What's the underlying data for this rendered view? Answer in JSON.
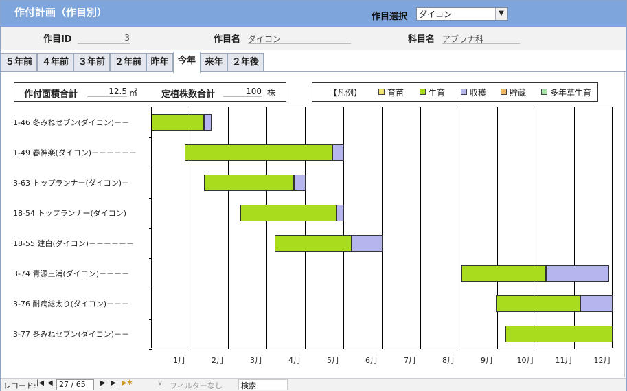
{
  "window": {
    "title": "作付計画（作目別）"
  },
  "header": {
    "crop_select_label": "作目選択",
    "crop_select_value": "ダイコン"
  },
  "info": {
    "crop_id_label": "作目ID",
    "crop_id_value": "3",
    "crop_name_label": "作目名",
    "crop_name_value": "ダイコン",
    "family_label": "科目名",
    "family_value": "アブラナ科"
  },
  "tabs": [
    {
      "label": "５年前"
    },
    {
      "label": "４年前"
    },
    {
      "label": "３年前"
    },
    {
      "label": "２年前"
    },
    {
      "label": "昨年"
    },
    {
      "label": "今年",
      "active": true
    },
    {
      "label": "来年"
    },
    {
      "label": "２年後"
    }
  ],
  "summary": {
    "area_label": "作付面積合計",
    "area_value": "12.5",
    "area_unit": "㎡",
    "plants_label": "定植株数合計",
    "plants_value": "100",
    "plants_unit": "株"
  },
  "legend": {
    "title": "【凡例】",
    "items": [
      {
        "label": "育苗",
        "color": "#f0e070"
      },
      {
        "label": "生育",
        "color": "#a8dc1c"
      },
      {
        "label": "収穫",
        "color": "#b6b6ee"
      },
      {
        "label": "貯蔵",
        "color": "#f4b860"
      },
      {
        "label": "多年草生育",
        "color": "#a4e4a4"
      }
    ]
  },
  "chart_data": {
    "type": "bar",
    "orientation": "horizontal-gantt",
    "months": [
      "1月",
      "2月",
      "3月",
      "4月",
      "5月",
      "6月",
      "7月",
      "8月",
      "9月",
      "10月",
      "11月",
      "12月"
    ],
    "x_range": [
      0,
      12
    ],
    "rows": [
      {
        "label": "1-46 冬みねセブン(ダイコン)－－",
        "grow": [
          0.0,
          1.35
        ],
        "harvest": [
          1.35,
          1.55
        ]
      },
      {
        "label": "1-49 春神楽(ダイコン)－－－－－－",
        "grow": [
          0.85,
          4.7
        ],
        "harvest": [
          4.7,
          5.0
        ]
      },
      {
        "label": "3-63 トップランナー(ダイコン)－",
        "grow": [
          1.35,
          3.7
        ],
        "harvest": [
          3.7,
          4.0
        ]
      },
      {
        "label": "18-54 トップランナー(ダイコン)",
        "grow": [
          2.3,
          4.8
        ],
        "harvest": [
          4.8,
          5.0
        ]
      },
      {
        "label": "18-55 建白(ダイコン)－－－－－－",
        "grow": [
          3.2,
          5.2
        ],
        "harvest": [
          5.2,
          6.0
        ]
      },
      {
        "label": "3-74 青源三浦(ダイコン)－－－－",
        "grow": [
          8.05,
          10.25
        ],
        "harvest": [
          10.25,
          11.9
        ]
      },
      {
        "label": "3-76 耐病総太り(ダイコン)－－－",
        "grow": [
          8.95,
          11.15
        ],
        "harvest": [
          11.15,
          12.0
        ]
      },
      {
        "label": "3-77 冬みねセブン(ダイコン)－－",
        "grow": [
          9.2,
          12.0
        ],
        "harvest": null
      }
    ]
  },
  "statusbar": {
    "record_label": "レコード:",
    "record_value": "27 / 65",
    "filter_label": "フィルターなし",
    "search_label": "検索"
  }
}
